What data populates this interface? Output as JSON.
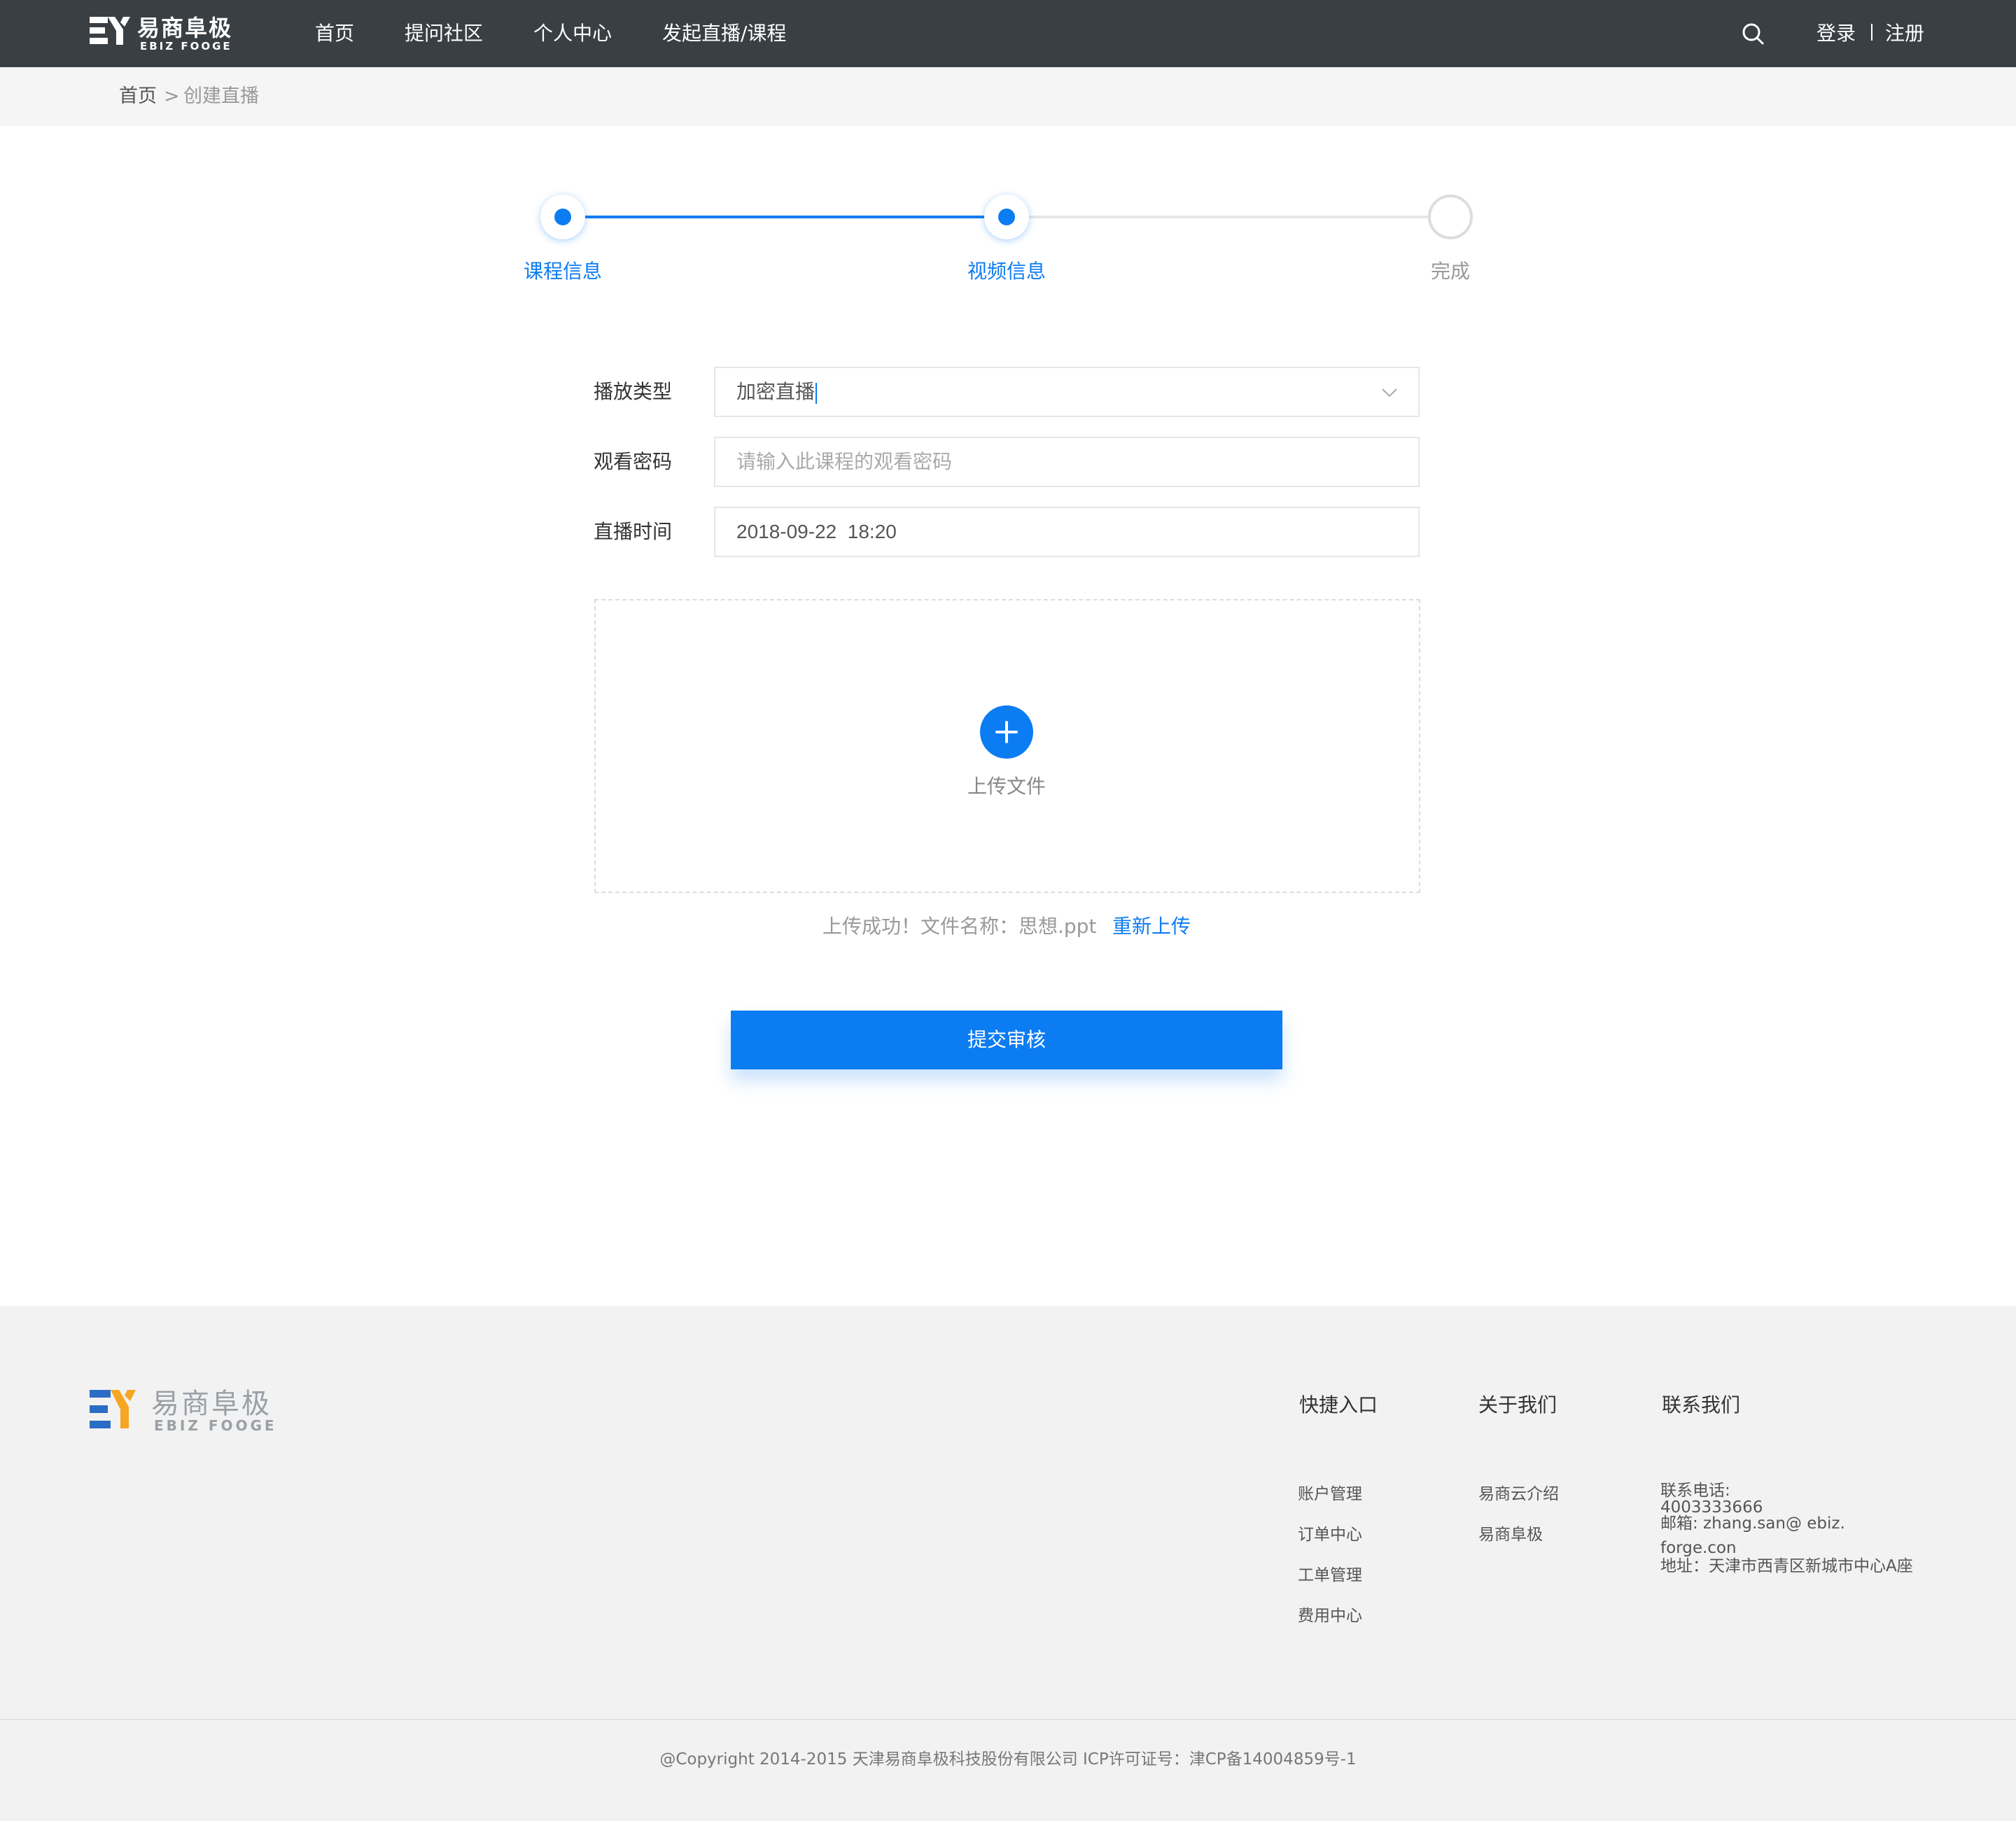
{
  "header": {
    "logo_cn": "易商阜极",
    "logo_en": "EBIZ FOOGE",
    "nav": [
      "首页",
      "提问社区",
      "个人中心",
      "发起直播/课程"
    ],
    "login": "登录",
    "register": "注册"
  },
  "breadcrumb": {
    "home": "首页",
    "separator": ">",
    "current": "创建直播"
  },
  "steps": [
    {
      "label": "课程信息",
      "state": "done"
    },
    {
      "label": "视频信息",
      "state": "active"
    },
    {
      "label": "完成",
      "state": "pending"
    }
  ],
  "form": {
    "play_type_label": "播放类型",
    "play_type_value": "加密直播",
    "password_label": "观看密码",
    "password_placeholder": "请输入此课程的观看密码",
    "time_label": "直播时间",
    "time_value": "2018-09-22  18:20"
  },
  "upload": {
    "label": "上传文件",
    "status": "上传成功！文件名称：思想.ppt",
    "reupload": "重新上传"
  },
  "submit_label": "提交审核",
  "footer": {
    "logo_cn": "易商阜极",
    "logo_en": "EBIZ FOOGE",
    "quick": {
      "title": "快捷入口",
      "links": [
        "账户管理",
        "订单中心",
        "工单管理",
        "费用中心"
      ]
    },
    "about": {
      "title": "关于我们",
      "links": [
        "易商云介绍",
        "易商阜极"
      ]
    },
    "contact": {
      "title": "联系我们",
      "phone_label": "联系电话:",
      "phone": "4003333666",
      "email_line1": "邮箱: zhang.san@ ebiz.",
      "email_line2": "forge.con",
      "address": "地址：天津市西青区新城市中心A座"
    },
    "copyright": "@Copyright 2014-2015 天津易商阜极科技股份有限公司 ICP许可证号：津CP备14004859号-1"
  },
  "colors": {
    "accent": "#0c7cf2",
    "header_bg": "#3a3f44",
    "footer_bg": "#f2f2f2"
  }
}
